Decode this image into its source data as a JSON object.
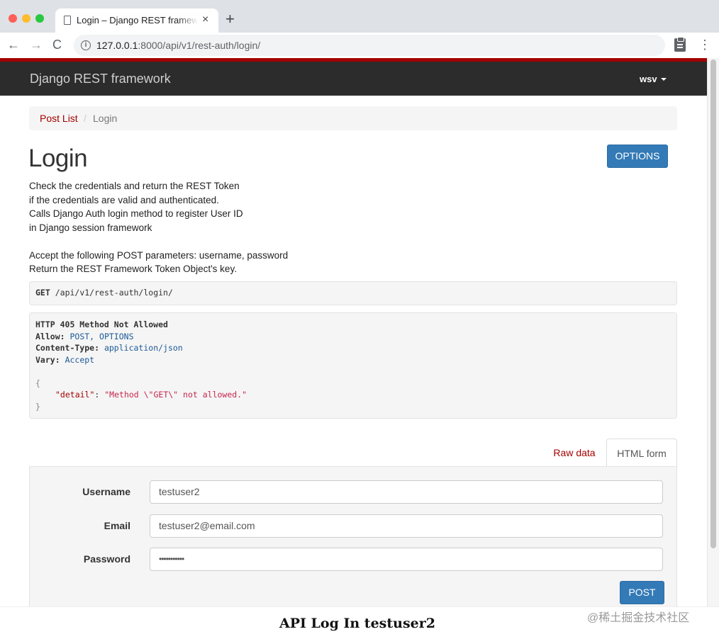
{
  "browser": {
    "tab_title": "Login – Django REST framework",
    "tab_close": "×",
    "new_tab": "+",
    "back": "←",
    "forward": "→",
    "reload": "C",
    "url_host": "127.0.0.1",
    "url_path": ":8000/api/v1/rest-auth/login/",
    "menu": "⋮",
    "info_icon": "i"
  },
  "navbar": {
    "brand": "Django REST framework",
    "user": "wsv"
  },
  "breadcrumb": {
    "items": [
      "Post List",
      "Login"
    ],
    "separator": "/"
  },
  "page": {
    "title": "Login",
    "options_label": "OPTIONS",
    "description": [
      "Check the credentials and return the REST Token",
      "if the credentials are valid and authenticated.",
      "Calls Django Auth login method to register User ID",
      "in Django session framework",
      "",
      "Accept the following POST parameters: username, password",
      "Return the REST Framework Token Object's key."
    ]
  },
  "request": {
    "method": "GET",
    "path": "/api/v1/rest-auth/login/"
  },
  "response": {
    "status_line": "HTTP 405 Method Not Allowed",
    "headers": [
      {
        "name": "Allow:",
        "value": "POST, OPTIONS"
      },
      {
        "name": "Content-Type:",
        "value": "application/json"
      },
      {
        "name": "Vary:",
        "value": "Accept"
      }
    ],
    "open_brace": "{",
    "body_key": "\"detail\"",
    "body_colon": ": ",
    "body_value": "\"Method \\\"GET\\\" not allowed.\"",
    "close_brace": "}"
  },
  "form_tabs": {
    "raw": "Raw data",
    "html": "HTML form"
  },
  "form": {
    "username_label": "Username",
    "username_value": "testuser2",
    "email_label": "Email",
    "email_value": "testuser2@email.com",
    "password_label": "Password",
    "password_value": "•••••••••••",
    "submit_label": "POST"
  },
  "caption": "API Log In testuser2",
  "watermark": "@稀土掘金技术社区"
}
